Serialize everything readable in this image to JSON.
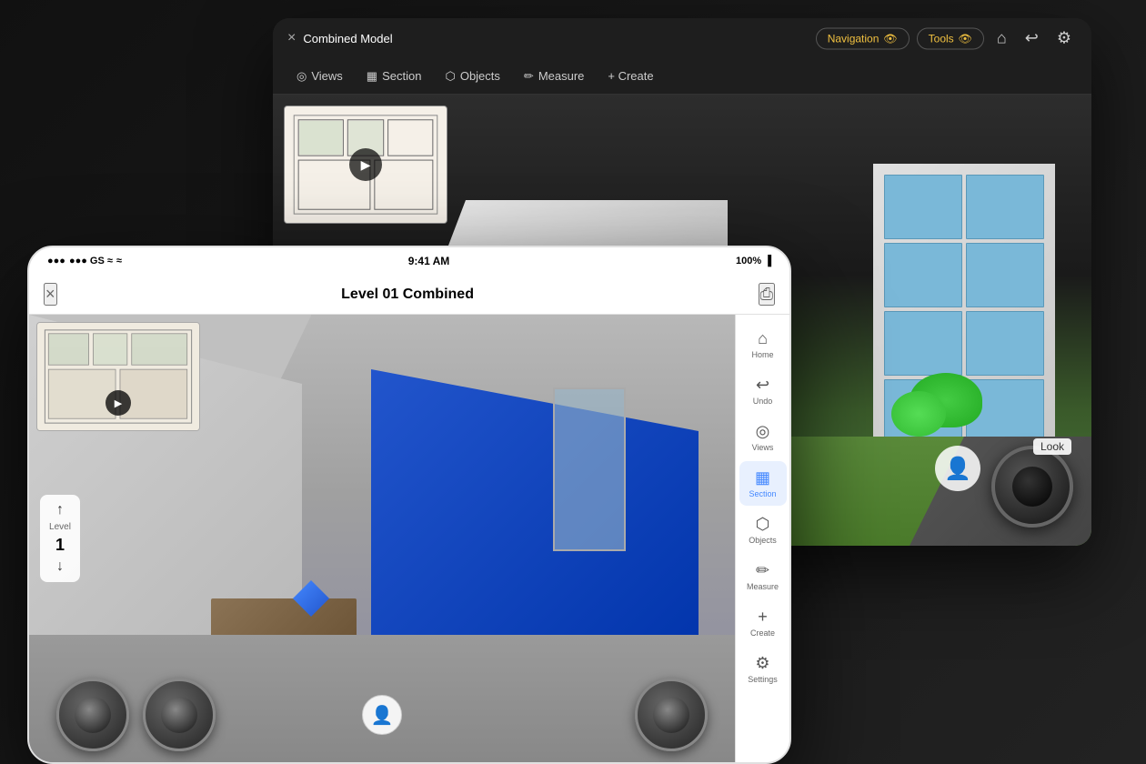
{
  "desktop": {
    "title": "Combined Model",
    "close_label": "×",
    "toolbar": {
      "navigation_label": "Navigation",
      "tools_label": "Tools",
      "home_icon": "⌂",
      "undo_icon": "↩",
      "settings_icon": "⚙"
    },
    "second_toolbar": {
      "views_label": "Views",
      "section_label": "Section",
      "objects_label": "Objects",
      "measure_label": "Measure",
      "create_label": "+ Create"
    }
  },
  "mobile": {
    "status_bar": {
      "signal": "●●● GS ≈",
      "time": "9:41 AM",
      "battery": "100%"
    },
    "title": "Level 01 Combined",
    "sidebar": {
      "items": [
        {
          "id": "home",
          "label": "Home",
          "icon": "⌂"
        },
        {
          "id": "undo",
          "label": "Undo",
          "icon": "↩"
        },
        {
          "id": "views",
          "label": "Views",
          "icon": "◎"
        },
        {
          "id": "section",
          "label": "Section",
          "icon": "▦",
          "active": true
        },
        {
          "id": "objects",
          "label": "Objects",
          "icon": "⬡"
        },
        {
          "id": "measure",
          "label": "Measure",
          "icon": "✏"
        },
        {
          "id": "create",
          "label": "Create",
          "icon": "+"
        },
        {
          "id": "settings",
          "label": "Settings",
          "icon": "⚙"
        }
      ]
    },
    "level": {
      "label": "Level",
      "number": "1"
    }
  },
  "icons": {
    "close": "×",
    "share": "⎙",
    "eye": "●",
    "play": "▶",
    "up_arrow": "↑",
    "down_arrow": "↓",
    "person": "👤"
  }
}
